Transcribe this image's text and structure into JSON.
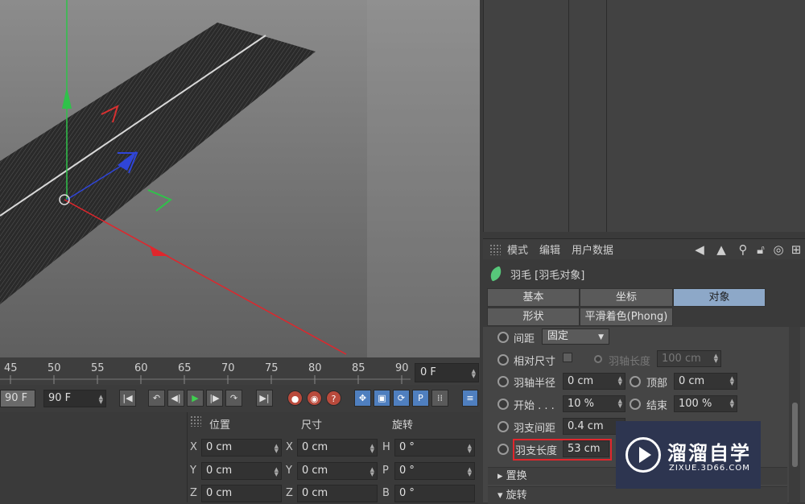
{
  "attribute_manager": {
    "menu": [
      "模式",
      "编辑",
      "用户数据"
    ],
    "toolbar_icons": [
      "arrow-left-icon",
      "arrow-up-icon",
      "search-icon",
      "lock-icon",
      "target-icon",
      "add-icon"
    ],
    "object_title": "羽毛 [羽毛对象]",
    "tabs_row1": [
      "基本",
      "坐标",
      "对象"
    ],
    "tabs_row2": [
      "形状",
      "平滑着色(Phong)"
    ],
    "active_tab": "对象",
    "params": {
      "spacing_label": "间距",
      "spacing_value": "固定",
      "relative_size_label": "相对尺寸",
      "shaft_length_label": "羽轴长度",
      "shaft_length_value": "100 cm",
      "shaft_radius_label": "羽轴半径",
      "shaft_radius_value": "0 cm",
      "top_label": "顶部",
      "top_value": "0 cm",
      "start_label": "开始 . . .",
      "start_value": "10 %",
      "end_label": "结束",
      "end_value": "100 %",
      "barb_spacing_label": "羽支间距",
      "barb_spacing_value": "0.4 cm",
      "barb_length_label": "羽支长度",
      "barb_length_value": "53 cm"
    },
    "sections": [
      "置换",
      "旋转"
    ]
  },
  "timeline": {
    "ticks": [
      "45",
      "50",
      "55",
      "60",
      "65",
      "70",
      "75",
      "80",
      "85",
      "90"
    ],
    "current_frame": "0 F",
    "start_field": "90 F",
    "end_field": "90 F"
  },
  "coordinates": {
    "headers": [
      "位置",
      "尺寸",
      "旋转"
    ],
    "position": [
      {
        "axis": "X",
        "value": "0 cm"
      },
      {
        "axis": "Y",
        "value": "0 cm"
      },
      {
        "axis": "Z",
        "value": "0 cm"
      }
    ],
    "size": [
      {
        "axis": "X",
        "value": "0 cm"
      },
      {
        "axis": "Y",
        "value": "0 cm"
      },
      {
        "axis": "Z",
        "value": "0 cm"
      }
    ],
    "rotation": [
      {
        "axis": "H",
        "value": "0 °"
      },
      {
        "axis": "P",
        "value": "0 °"
      },
      {
        "axis": "B",
        "value": "0 °"
      }
    ]
  },
  "watermark": {
    "name": "溜溜自学",
    "url": "ZIXUE.3D66.COM"
  },
  "colors": {
    "active_tab": "#8da8c8",
    "highlight_box": "#e0262c",
    "axis_x": "#e0262c",
    "axis_y": "#2fc24a",
    "axis_z": "#2f45d8"
  }
}
